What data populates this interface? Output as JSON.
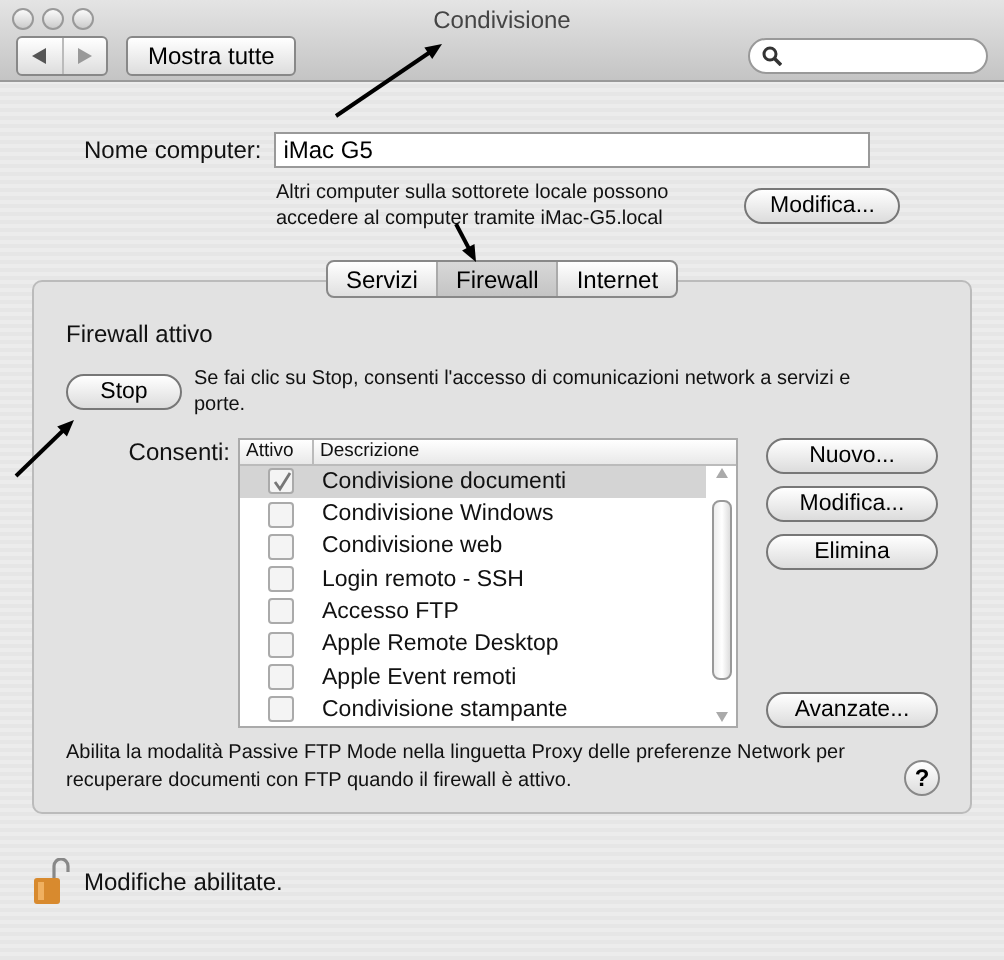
{
  "window": {
    "title": "Condivisione"
  },
  "toolbar": {
    "show_all": "Mostra tutte"
  },
  "computer_name": {
    "label": "Nome computer:",
    "value": "iMac G5",
    "info": "Altri computer sulla sottorete locale possono accedere al computer tramite iMac-G5.local",
    "button": "Modifica..."
  },
  "tabs": [
    {
      "label": "Servizi",
      "selected": false
    },
    {
      "label": "Firewall",
      "selected": true
    },
    {
      "label": "Internet",
      "selected": false
    }
  ],
  "firewall": {
    "status": "Firewall attivo",
    "stop_button": "Stop",
    "stop_info": "Se fai clic su Stop, consenti l'accesso di comunicazioni network a servizi e porte.",
    "allow_label": "Consenti:",
    "table": {
      "columns": [
        "Attivo",
        "Descrizione"
      ],
      "rows": [
        {
          "name": "Condivisione documenti",
          "checked": true,
          "selected": true
        },
        {
          "name": "Condivisione Windows",
          "checked": false,
          "selected": false
        },
        {
          "name": "Condivisione web",
          "checked": false,
          "selected": false
        },
        {
          "name": "Login remoto - SSH",
          "checked": false,
          "selected": false
        },
        {
          "name": "Accesso FTP",
          "checked": false,
          "selected": false
        },
        {
          "name": "Apple Remote Desktop",
          "checked": false,
          "selected": false
        },
        {
          "name": "Apple Event remoti",
          "checked": false,
          "selected": false
        },
        {
          "name": "Condivisione stampante",
          "checked": false,
          "selected": false
        }
      ]
    },
    "buttons": [
      "Nuovo...",
      "Modifica...",
      "Elimina"
    ],
    "advanced_button": "Avanzate...",
    "note": "Abilita la modalità Passive FTP Mode nella linguetta Proxy delle preferenze Network per recuperare documenti con FTP quando il firewall è attivo.",
    "help": "?"
  },
  "lock": {
    "text": "Modifiche abilitate."
  }
}
